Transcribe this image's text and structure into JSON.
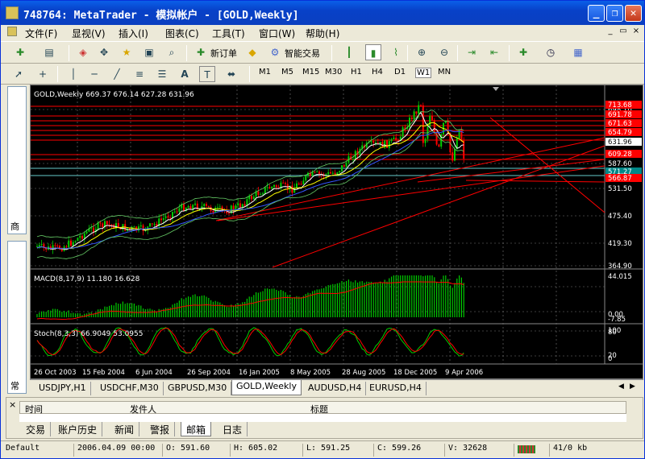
{
  "window": {
    "title": "748764: MetaTrader - 模拟帐户 - [GOLD,Weekly]",
    "minimize": "_",
    "restore": "❐",
    "close": "✕"
  },
  "menu": [
    "文件(F)",
    "显视(V)",
    "插入(I)",
    "图表(C)",
    "工具(T)",
    "窗口(W)",
    "帮助(H)"
  ],
  "mdi_controls": {
    "minimize": "_",
    "restore": "▭",
    "close": "×"
  },
  "toolbar1": {
    "new_order": "新订单",
    "expert": "智能交易"
  },
  "timeframes": [
    "M1",
    "M5",
    "M15",
    "M30",
    "H1",
    "H4",
    "D1",
    "W1",
    "MN"
  ],
  "selected_timeframe": "W1",
  "left_panel": {
    "market_watch_tab": "商",
    "navigator_tab": "常"
  },
  "chart": {
    "header": "GOLD,Weekly  669.37 676.14 627.28 631.96",
    "macd_label": "MACD(8,17,9) 11.180 16.628",
    "stoch_label": "Stoch(8,3,3) 66.9049 53.0955",
    "price_ticks": [
      "698.10",
      "587.60",
      "531.50",
      "475.40",
      "419.30",
      "364.90"
    ],
    "price_tags": [
      "713.68",
      "691.78",
      "671.63",
      "654.79",
      "631.96",
      "609.28",
      "571.27",
      "566.87"
    ],
    "macd_ticks": [
      "44.015",
      "0.00",
      "-7.85"
    ],
    "stoch_ticks": [
      "100",
      "80",
      "20",
      "0"
    ],
    "dates": [
      "26 Oct 2003",
      "15 Feb 2004",
      "6 Jun 2004",
      "26 Sep 2004",
      "16 Jan 2005",
      "8 May 2005",
      "28 Aug 2005",
      "18 Dec 2005",
      "9 Apr 2006"
    ],
    "colors": {
      "bg": "#000000",
      "bull": "#00cc00",
      "bear": "#ff0000",
      "grid": "#777777",
      "text": "#ffffff",
      "ma": "#ffff00",
      "macd_hist": "#00cc00",
      "macd_signal": "#ff0000",
      "stoch_main": "#00cc00",
      "stoch_signal": "#ff0000",
      "level_lines": "#ff0000",
      "cyan_lines": "#66cccc",
      "tag_red": "#ff0000"
    }
  },
  "chart_tabs": [
    "USDJPY,H1",
    "USDCHF,M30",
    "GBPUSD,M30",
    "GOLD,Weekly",
    "AUDUSD,H4",
    "EURUSD,H4"
  ],
  "selected_chart_tab": "GOLD,Weekly",
  "terminal": {
    "columns": [
      "时间",
      "发件人",
      "标题"
    ],
    "tabs": [
      "交易",
      "账户历史",
      "新闻",
      "警报",
      "邮箱",
      "日志"
    ],
    "selected_tab": "邮箱",
    "close": "×"
  },
  "status": {
    "profile": "Default",
    "time": "2006.04.09 00:00",
    "open": "O: 591.60",
    "high": "H: 605.02",
    "low": "L: 591.25",
    "close": "C: 599.26",
    "volume": "V: 32628",
    "traffic": "41/0 kb"
  }
}
